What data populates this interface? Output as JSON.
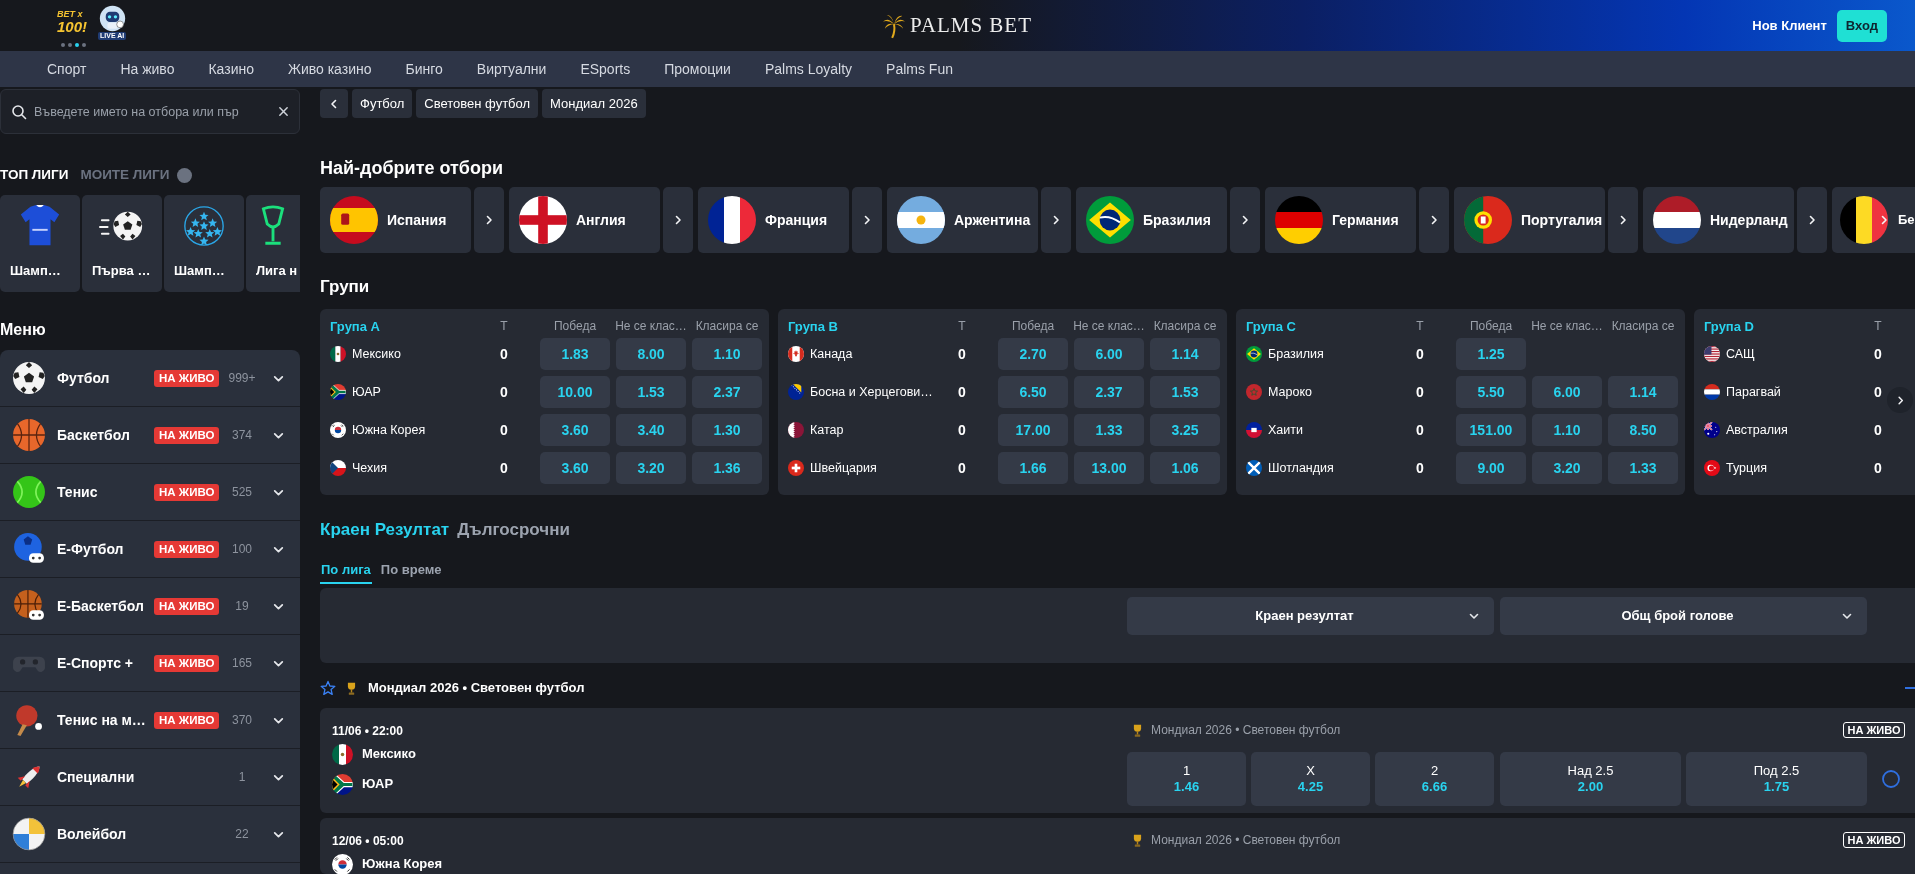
{
  "header": {
    "promos": [
      {
        "kind": "bet",
        "lines": [
          "BET x",
          "100!"
        ]
      },
      {
        "kind": "robot",
        "caption": "LIVE AI"
      }
    ],
    "carousel_dots": [
      {
        "selected": false
      },
      {
        "selected": false
      },
      {
        "selected": true
      },
      {
        "selected": false
      }
    ],
    "logo": "PALMS BET",
    "register_link": "Нов Клиент",
    "login_button": "Вход"
  },
  "nav": [
    "Спорт",
    "На живо",
    "Казино",
    "Живо казино",
    "Бинго",
    "Виртуални",
    "ESports",
    "Промоции",
    "Palms Loyalty",
    "Palms Fun"
  ],
  "sidebar": {
    "search": {
      "placeholder": "Въведете името на отбора или пър"
    },
    "league_tabs": [
      {
        "label": "ТОП ЛИГИ",
        "selected": true
      },
      {
        "label": "МОИТЕ ЛИГИ",
        "selected": false
      }
    ],
    "top_leagues": [
      {
        "label": "Шамп…"
      },
      {
        "label": "Първа …"
      },
      {
        "label": "Шамп…"
      },
      {
        "label": "Лига н"
      }
    ],
    "menu_title": "Меню",
    "menu": [
      {
        "name": "Футбол",
        "live_badge": "НА ЖИВО",
        "count": "999+"
      },
      {
        "name": "Баскетбол",
        "live_badge": "НА ЖИВО",
        "count": "374"
      },
      {
        "name": "Тенис",
        "live_badge": "НА ЖИВО",
        "count": "525"
      },
      {
        "name": "Е-Футбол",
        "live_badge": "НА ЖИВО",
        "count": "100"
      },
      {
        "name": "Е-Баскетбол",
        "live_badge": "НА ЖИВО",
        "count": "19"
      },
      {
        "name": "Е-Спортс +",
        "live_badge": "НА ЖИВО",
        "count": "165"
      },
      {
        "name": "Тенис на м…",
        "live_badge": "НА ЖИВО",
        "count": "370"
      },
      {
        "name": "Специални",
        "count": "1"
      },
      {
        "name": "Волейбол",
        "count": "22"
      }
    ]
  },
  "breadcrumbs": [
    "Футбол",
    "Световен футбол",
    "Мондиал 2026"
  ],
  "top_teams": {
    "title": "Най-добрите отбори",
    "teams": [
      "Испания",
      "Англия",
      "Франция",
      "Аржентина",
      "Бразилия",
      "Германия",
      "Португалия",
      "Нидерланд",
      "Бе"
    ]
  },
  "groups": {
    "title": "Групи",
    "cards": [
      {
        "title": "Група A",
        "columns": [
          "T",
          "Победа",
          "Не се клас…",
          "Класира се"
        ],
        "rows": [
          {
            "team": "Мексико",
            "played": "0",
            "odds": [
              "1.83",
              "8.00",
              "1.10"
            ]
          },
          {
            "team": "ЮАР",
            "played": "0",
            "odds": [
              "10.00",
              "1.53",
              "2.37"
            ]
          },
          {
            "team": "Южна Корея",
            "played": "0",
            "odds": [
              "3.60",
              "3.40",
              "1.30"
            ]
          },
          {
            "team": "Чехия",
            "played": "0",
            "odds": [
              "3.60",
              "3.20",
              "1.36"
            ]
          }
        ]
      },
      {
        "title": "Група B",
        "columns": [
          "T",
          "Победа",
          "Не се клас…",
          "Класира се"
        ],
        "rows": [
          {
            "team": "Канада",
            "played": "0",
            "odds": [
              "2.70",
              "6.00",
              "1.14"
            ]
          },
          {
            "team": "Босна и Херцегови…",
            "played": "0",
            "odds": [
              "6.50",
              "2.37",
              "1.53"
            ]
          },
          {
            "team": "Катар",
            "played": "0",
            "odds": [
              "17.00",
              "1.33",
              "3.25"
            ]
          },
          {
            "team": "Швейцария",
            "played": "0",
            "odds": [
              "1.66",
              "13.00",
              "1.06"
            ]
          }
        ]
      },
      {
        "title": "Група C",
        "columns": [
          "T",
          "Победа",
          "Не се клас…",
          "Класира се"
        ],
        "rows": [
          {
            "team": "Бразилия",
            "played": "0",
            "odds": [
              "1.25"
            ]
          },
          {
            "team": "Мароко",
            "played": "0",
            "odds": [
              "5.50",
              "6.00",
              "1.14"
            ]
          },
          {
            "team": "Хаити",
            "played": "0",
            "odds": [
              "151.00",
              "1.10",
              "8.50"
            ]
          },
          {
            "team": "Шотландия",
            "played": "0",
            "odds": [
              "9.00",
              "3.20",
              "1.33"
            ]
          }
        ]
      },
      {
        "title": "Група D",
        "columns": [
          "T"
        ],
        "rows": [
          {
            "team": "САЩ",
            "played": "0"
          },
          {
            "team": "Парагвай",
            "played": "0"
          },
          {
            "team": "Австралия",
            "played": "0"
          },
          {
            "team": "Турция",
            "played": "0"
          }
        ]
      }
    ]
  },
  "markets": {
    "tabs": [
      {
        "label": "Краен Резултат",
        "selected": true
      },
      {
        "label": "Дългосрочни",
        "selected": false
      }
    ],
    "views": [
      {
        "label": "По лига",
        "selected": true
      },
      {
        "label": "По време",
        "selected": false
      }
    ],
    "selectors": [
      "Краен резултат",
      "Общ брой голове"
    ]
  },
  "league": {
    "title": "Мондиал 2026 • Световен футбол",
    "favorite": false,
    "matches": [
      {
        "time": "11/06 • 22:00",
        "competition": "Мондиал 2026 • Световен футбол",
        "live_badge": "НА ЖИВО",
        "teams": [
          "Мексико",
          "ЮАР"
        ],
        "markets": [
          {
            "outcomes": [
              {
                "label": "1",
                "value": "1.46"
              },
              {
                "label": "X",
                "value": "4.25"
              },
              {
                "label": "2",
                "value": "6.66"
              }
            ]
          },
          {
            "outcomes": [
              {
                "label": "Над 2.5",
                "value": "2.00"
              },
              {
                "label": "Под 2.5",
                "value": "1.75"
              }
            ]
          }
        ]
      },
      {
        "time": "12/06 • 05:00",
        "competition": "Мондиал 2026 • Световен футбол",
        "live_badge": "НА ЖИВО",
        "teams": [
          "Южна Корея"
        ]
      }
    ]
  }
}
